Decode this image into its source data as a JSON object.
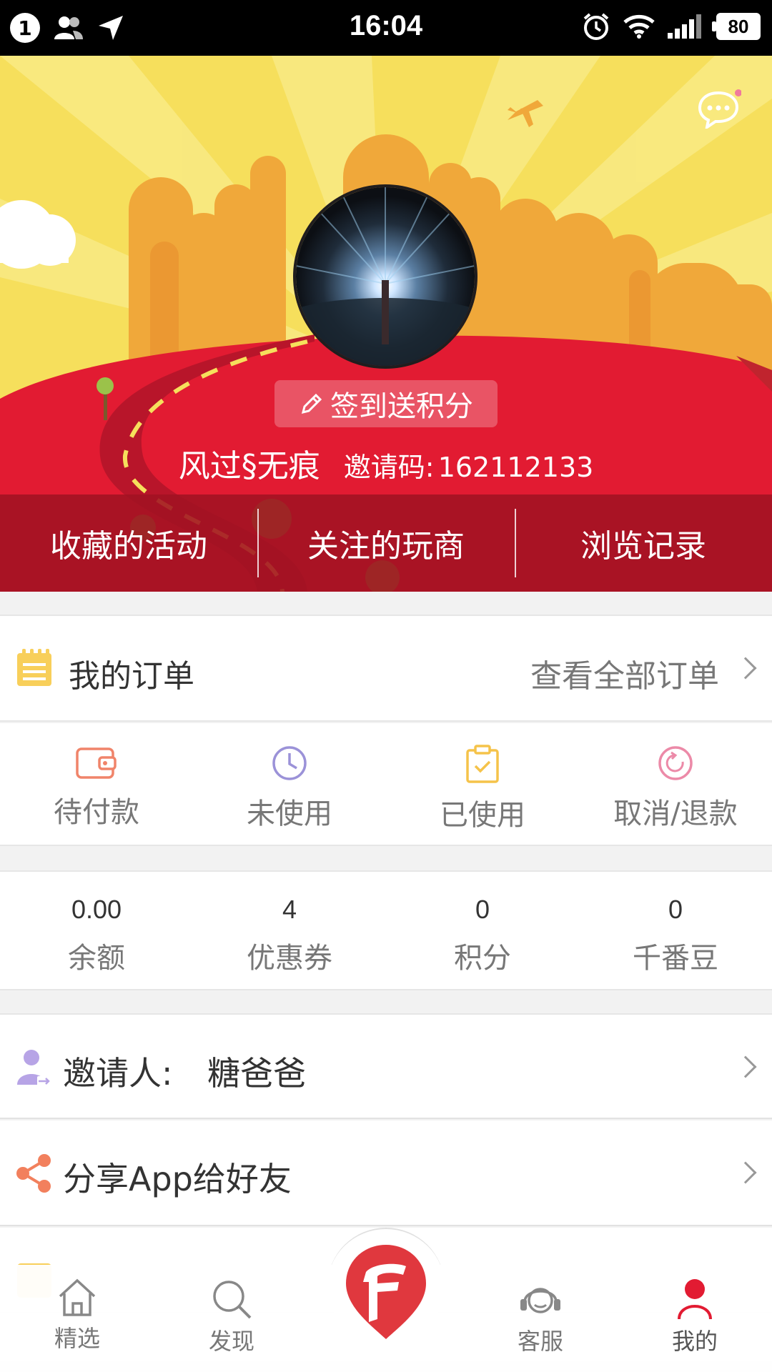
{
  "status_bar": {
    "notification_count": "1",
    "time": "16:04",
    "battery": "80"
  },
  "profile": {
    "signin_label": "签到送积分",
    "username": "风过§无痕",
    "invite_label": "邀请码:",
    "invite_code": "162112133"
  },
  "tabs": [
    {
      "label": "收藏的活动"
    },
    {
      "label": "关注的玩商"
    },
    {
      "label": "浏览记录"
    }
  ],
  "orders": {
    "title": "我的订单",
    "view_all": "查看全部订单",
    "statuses": [
      {
        "label": "待付款",
        "icon": "wallet-icon",
        "color": "#f0846a"
      },
      {
        "label": "未使用",
        "icon": "clock-icon",
        "color": "#9b92d8"
      },
      {
        "label": "已使用",
        "icon": "clipboard-check-icon",
        "color": "#f5c34a"
      },
      {
        "label": "取消/退款",
        "icon": "refund-icon",
        "color": "#ec8aa8"
      }
    ]
  },
  "assets": [
    {
      "value": "0.00",
      "label": "余额"
    },
    {
      "value": "4",
      "label": "优惠券"
    },
    {
      "value": "0",
      "label": "积分"
    },
    {
      "value": "0",
      "label": "千番豆"
    }
  ],
  "inviter": {
    "label": "邀请人:",
    "name": "糖爸爸"
  },
  "share": {
    "label": "分享App给好友"
  },
  "bottom_nav": [
    {
      "label": "精选",
      "icon": "home-icon"
    },
    {
      "label": "发现",
      "icon": "search-icon"
    },
    {
      "label": "",
      "icon": "brand-logo-icon"
    },
    {
      "label": "客服",
      "icon": "headset-icon"
    },
    {
      "label": "我的",
      "icon": "person-icon",
      "active": true
    }
  ],
  "colors": {
    "brand_red": "#e21b32",
    "tab_bar": "#a01222",
    "sky_yellow": "#f6df5c",
    "city_orange": "#f0a83a"
  }
}
